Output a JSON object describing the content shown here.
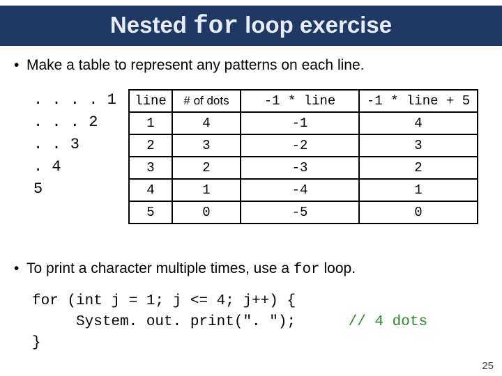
{
  "title": {
    "part1": "Nested ",
    "mono": "for",
    "part2": " loop exercise"
  },
  "bullet1": "Make a table to represent any patterns on each line.",
  "bullet2_pre": "To print a character multiple times, use a ",
  "bullet2_mono": "for",
  "bullet2_post": " loop.",
  "pattern_lines": [
    ". . . . 1",
    ". . . 2",
    ". . 3",
    ". 4",
    "5"
  ],
  "table": {
    "headers": {
      "c1": "line",
      "c2": "# of dots",
      "c3": "-1 * line",
      "c4": "-1 * line + 5"
    },
    "rows": [
      {
        "c1": "1",
        "c2": "4",
        "c3": "-1",
        "c4": "4"
      },
      {
        "c1": "2",
        "c2": "3",
        "c3": "-2",
        "c4": "3"
      },
      {
        "c1": "3",
        "c2": "2",
        "c3": "-3",
        "c4": "2"
      },
      {
        "c1": "4",
        "c2": "1",
        "c3": "-4",
        "c4": "1"
      },
      {
        "c1": "5",
        "c2": "0",
        "c3": "-5",
        "c4": "0"
      }
    ]
  },
  "code": {
    "line1": "for (int j = 1; j <= 4; j++) {",
    "line2_indent": "     System. out. print(\". \");",
    "line2_comment": "      // 4 dots",
    "line3": "}"
  },
  "page_number": "25",
  "chart_data": {
    "type": "table",
    "headers": [
      "line",
      "# of dots",
      "-1 * line",
      "-1 * line + 5"
    ],
    "rows": [
      [
        1,
        4,
        -1,
        4
      ],
      [
        2,
        3,
        -2,
        3
      ],
      [
        3,
        2,
        -3,
        2
      ],
      [
        4,
        1,
        -4,
        1
      ],
      [
        5,
        0,
        -5,
        0
      ]
    ]
  }
}
